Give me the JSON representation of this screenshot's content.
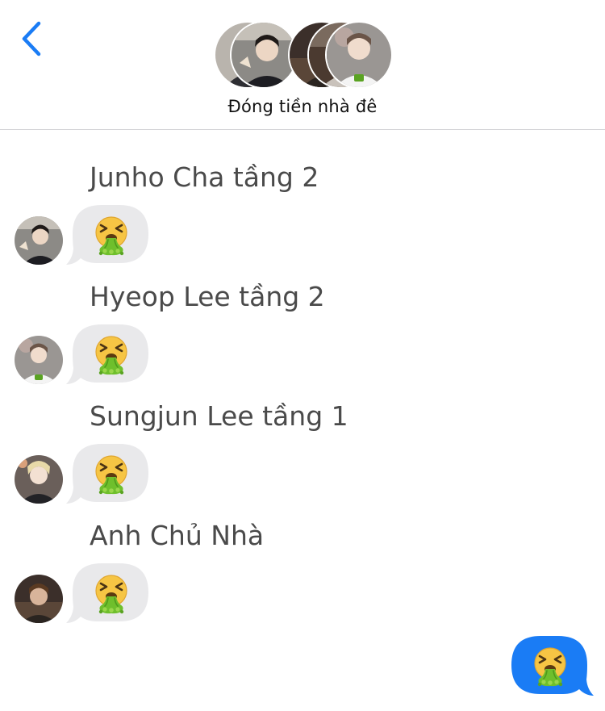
{
  "header": {
    "title": "Đóng tiền nhà đê",
    "back_icon": "chevron-left-icon",
    "accent_color": "#1a7cf5"
  },
  "messages": [
    {
      "sender": "Junho Cha tầng 2",
      "content": "nauseated-vomiting-emoji",
      "direction": "incoming"
    },
    {
      "sender": "Hyeop Lee tầng 2",
      "content": "nauseated-vomiting-emoji",
      "direction": "incoming"
    },
    {
      "sender": "Sungjun Lee tầng 1",
      "content": "nauseated-vomiting-emoji",
      "direction": "incoming"
    },
    {
      "sender": "Anh Chủ Nhà",
      "content": "nauseated-vomiting-emoji",
      "direction": "incoming"
    },
    {
      "content": "nauseated-vomiting-emoji",
      "direction": "outgoing"
    }
  ],
  "colors": {
    "incoming_bubble": "#e9e9eb",
    "outgoing_bubble": "#1a7cf5",
    "sender_name": "#4a4a4a",
    "divider": "#d4d4d8"
  }
}
